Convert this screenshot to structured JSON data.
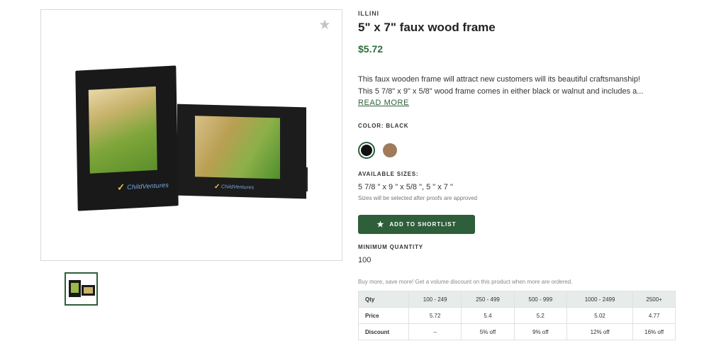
{
  "product": {
    "brand": "ILLINI",
    "title": "5\" x 7\" faux wood frame",
    "price": "$5.72",
    "description_line1": "This faux wooden frame will attract new customers will its beautiful craftsmanship!",
    "description_line2": "This 5 7/8\" x 9\" x 5/8\" wood frame comes in either black or walnut and includes a...",
    "read_more": "READ MORE",
    "image_logo_text": "ChildVentures"
  },
  "color": {
    "label": "COLOR: BLACK",
    "swatches": [
      {
        "name": "Black",
        "hex": "#111111",
        "selected": true
      },
      {
        "name": "Walnut",
        "hex": "#a07a5a",
        "selected": false
      }
    ]
  },
  "sizes": {
    "label": "AVAILABLE SIZES:",
    "value": "5 7/8 \" x 9 \" x 5/8 \", 5 \" x 7 \"",
    "note": "Sizes will be selected after proofs are approved"
  },
  "actions": {
    "shortlist_label": "ADD TO SHORTLIST"
  },
  "minimum_quantity": {
    "label": "MINIMUM QUANTITY",
    "value": "100"
  },
  "pricing": {
    "promo": "Buy more, save more! Get a volume discount on this product when more are ordered.",
    "header": [
      "Qty",
      "100 - 249",
      "250 - 499",
      "500 - 999",
      "1000 - 2499",
      "2500+"
    ],
    "price_row": [
      "Price",
      "5.72",
      "5.4",
      "5.2",
      "5.02",
      "4.77"
    ],
    "discount_row": [
      "Discount",
      "--",
      "5% off",
      "9% off",
      "12% off",
      "16% off"
    ]
  },
  "colors": {
    "accent": "#2e5e3a",
    "price": "#2e6d3d"
  },
  "icons": {
    "favorite": "star-icon",
    "shortlist": "star-icon"
  }
}
